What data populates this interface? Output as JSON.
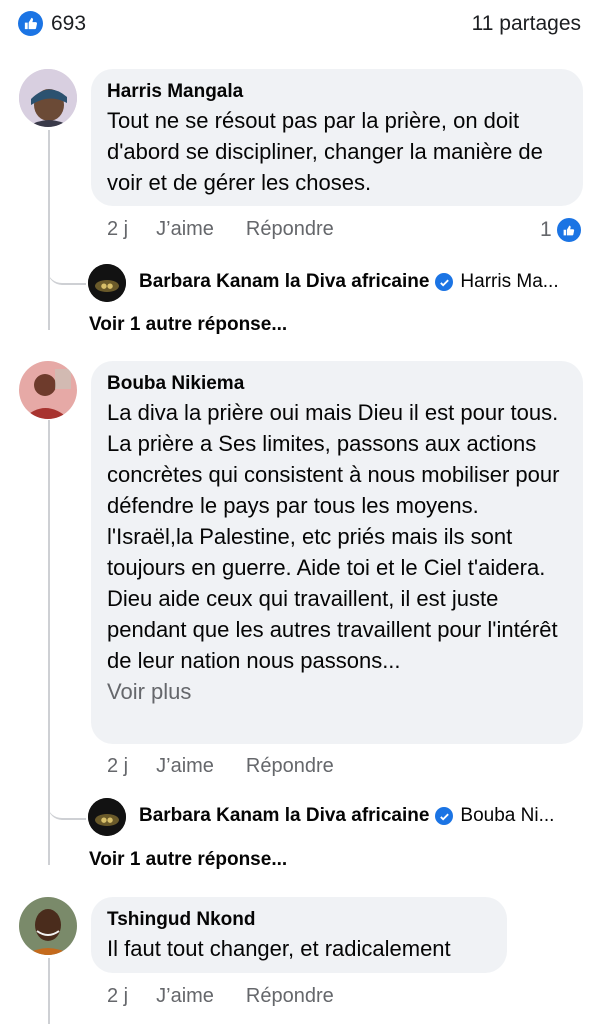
{
  "header": {
    "likes_count": "693",
    "shares": "11 partages"
  },
  "colors": {
    "accent": "#1b74e4",
    "bubble": "#f0f2f5",
    "meta_text": "#65676b"
  },
  "comments": [
    {
      "author": "Harris Mangala",
      "text": "Tout ne se résout pas par la prière, on doit d'abord se discipliner, changer la manière de voir et de gérer les choses.",
      "time": "2 j",
      "like_label": "J’aime",
      "reply_label": "Répondre",
      "reaction_count": "1",
      "reply": {
        "author": "Barbara Kanam la Diva africaine",
        "snippet": "Harris Ma..."
      },
      "more_replies": "Voir 1 autre réponse..."
    },
    {
      "author": "Bouba Nikiema",
      "text": "La diva la prière oui mais Dieu il est pour tous. La prière a Ses limites, passons aux actions concrètes qui consistent à nous mobiliser pour défendre le pays par tous les moyens. l'Israël,la Palestine, etc priés mais ils sont toujours en guerre. Aide toi et le Ciel t'aidera.\nDieu aide ceux qui travaillent, il est juste pendant que les autres travaillent pour l'intérêt de leur nation nous passons...",
      "see_more": "Voir plus",
      "time": "2 j",
      "like_label": "J’aime",
      "reply_label": "Répondre",
      "reply": {
        "author": "Barbara Kanam la Diva africaine",
        "snippet": "Bouba Ni..."
      },
      "more_replies": "Voir 1 autre réponse..."
    },
    {
      "author": "Tshingud Nkond",
      "text": "Il faut tout changer, et radicalement",
      "time": "2 j",
      "like_label": "J’aime",
      "reply_label": "Répondre"
    }
  ],
  "icons": {
    "like": "thumbs-up-icon",
    "verified": "verified-badge-icon"
  }
}
